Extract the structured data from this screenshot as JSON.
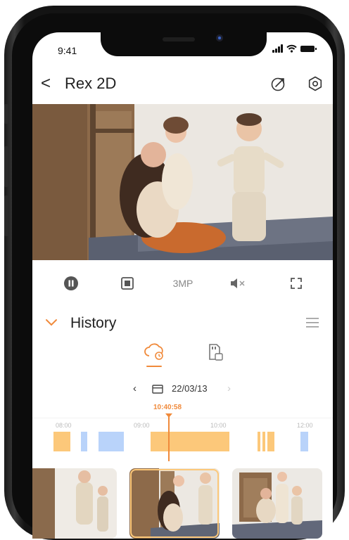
{
  "status_bar": {
    "time": "9:41"
  },
  "header": {
    "back_glyph": "<",
    "title": "Rex 2D",
    "icons": [
      "share-icon",
      "settings-icon"
    ]
  },
  "player_controls": {
    "pause_icon": "pause-icon",
    "record_icon": "record-icon",
    "resolution_label": "3MP",
    "mute_icon": "mute-icon",
    "fullscreen_icon": "fullscreen-icon"
  },
  "history": {
    "title": "History",
    "source_tabs": [
      {
        "name": "cloud",
        "icon": "cloud-icon",
        "selected": true
      },
      {
        "name": "sd-card",
        "icon": "sd-card-icon",
        "selected": false
      }
    ],
    "date": {
      "prev": "‹",
      "value": "22/03/13",
      "next": "›"
    },
    "timeline": {
      "current_time": "10:40:58",
      "ticks": [
        "08:00",
        "09:00",
        "10:00",
        "12:00"
      ]
    }
  },
  "colors": {
    "accent": "#f08a3b",
    "clip_motion": "#fcc87a",
    "clip_continuous": "#b9d3fa",
    "text": "#222222"
  }
}
